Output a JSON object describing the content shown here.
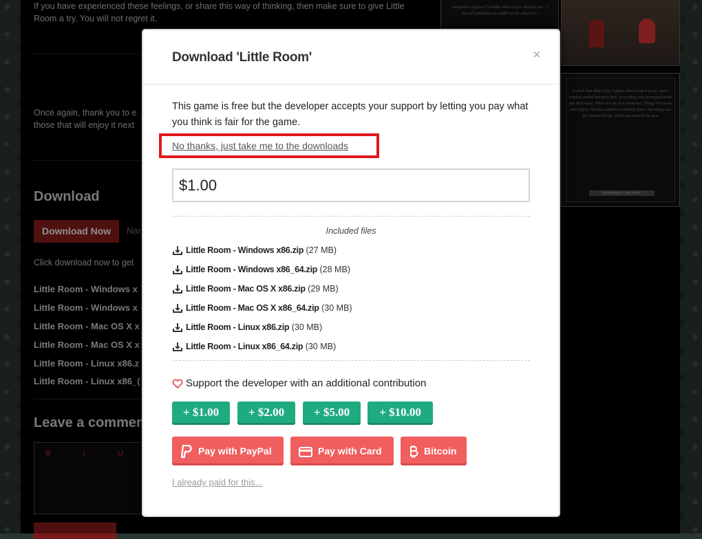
{
  "background_page": {
    "intro_text": "If you have experienced these feelings, or share this way of thinking, then make sure to give Little Room a try. You will not regret it.",
    "thanks_text": "Once again, thank you to e those that will enjoy it next",
    "download_heading": "Download",
    "download_now_label": "Download Now",
    "name_your_price": "Nar",
    "download_hint": "Click download now to get",
    "files": [
      "Little Room - Windows x",
      "Little Room - Windows x",
      "Little Room - Mac OS X x",
      "Little Room - Mac OS X x",
      "Little Room - Linux x86.z",
      "Little Room - Linux x86_("
    ],
    "comment_heading": "Leave a commen",
    "comment_toolbar": "B I U S ≡"
  },
  "screenshots": {
    "shot1_text": "Somewhere I guess? I wonder what it says. Had for me... I lost all motivation to cuddle on the sheet now",
    "shot3_text": "A clock that didn't tick. A ghost which looked in my. And a window sealed behind a lock. Everything was arranged inside this little room. There are my first memories. Things I've never seen before, but that somehow I already knew. One thing was for certain though. There was more to be seen",
    "shot3_button": "Something on your mind?"
  },
  "modal": {
    "title": "Download 'Little Room'",
    "close_symbol": "×",
    "free_text": "This game is free but the developer accepts your support by letting you pay what you think is fair for the game.",
    "no_thanks_link": "No thanks, just take me to the downloads",
    "price_value": "$1.00",
    "included_files_label": "Included files",
    "files": [
      {
        "name": "Little Room - Windows x86.zip",
        "size": "(27 MB)"
      },
      {
        "name": "Little Room - Windows x86_64.zip",
        "size": "(28 MB)"
      },
      {
        "name": "Little Room - Mac OS X x86.zip",
        "size": "(29 MB)"
      },
      {
        "name": "Little Room - Mac OS X x86_64.zip",
        "size": "(30 MB)"
      },
      {
        "name": "Little Room - Linux x86.zip",
        "size": "(30 MB)"
      },
      {
        "name": "Little Room - Linux x86_64.zip",
        "size": "(30 MB)"
      }
    ],
    "support_text": "Support the developer with an additional contribution",
    "tip_buttons": [
      "+ $1.00",
      "+ $2.00",
      "+ $5.00",
      "+ $10.00"
    ],
    "pay_buttons": {
      "paypal": "Pay with PayPal",
      "card": "Pay with Card",
      "bitcoin": "Bitcoin"
    },
    "already_paid_link": "I already paid for this..."
  },
  "colors": {
    "highlight_box": "#e0181d",
    "tip_green": "#1fab80",
    "pay_red": "#f15e5e"
  }
}
